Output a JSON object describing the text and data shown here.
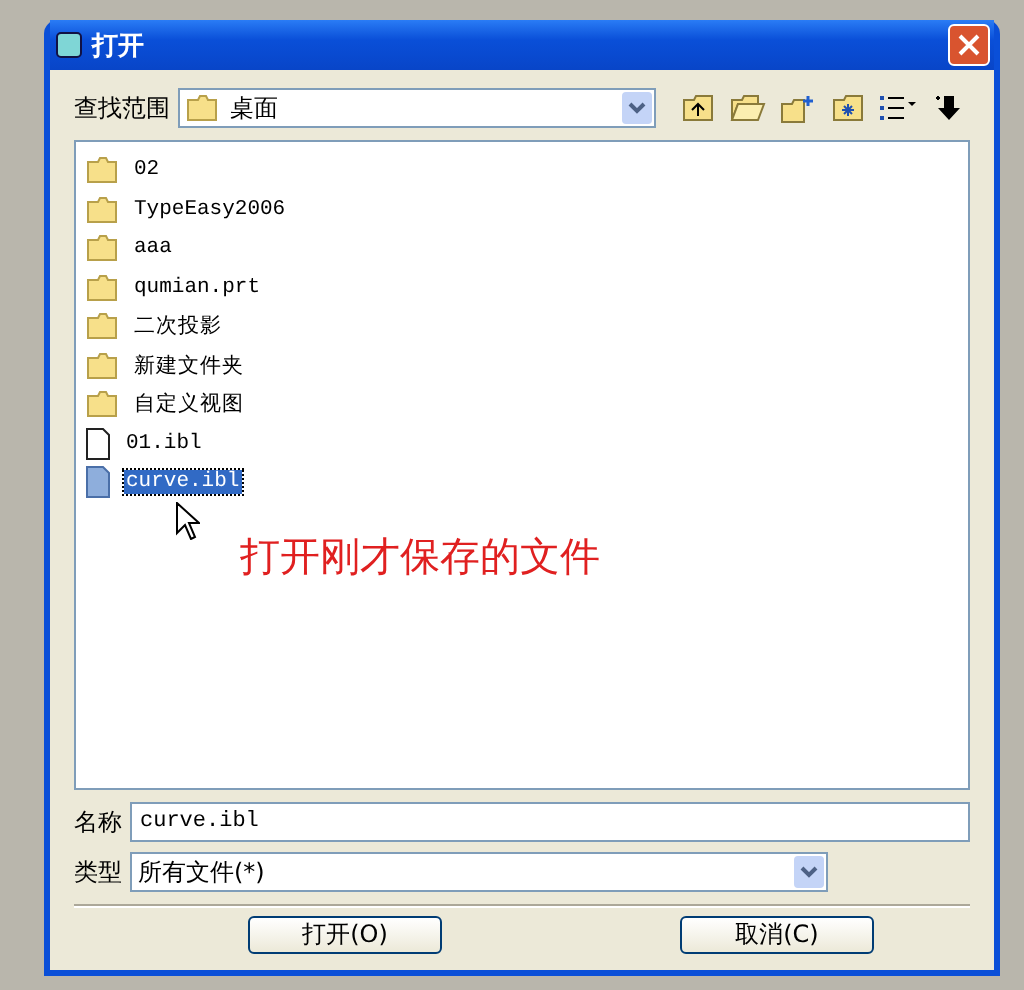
{
  "window": {
    "title": "打开"
  },
  "look_in": {
    "label": "查找范围",
    "value": "桌面"
  },
  "files": [
    {
      "name": "02",
      "kind": "folder",
      "selected": false
    },
    {
      "name": "TypeEasy2006",
      "kind": "folder",
      "selected": false
    },
    {
      "name": "aaa",
      "kind": "folder",
      "selected": false
    },
    {
      "name": "qumian.prt",
      "kind": "folder",
      "selected": false
    },
    {
      "name": "二次投影",
      "kind": "folder",
      "selected": false
    },
    {
      "name": "新建文件夹",
      "kind": "folder",
      "selected": false
    },
    {
      "name": "自定义视图",
      "kind": "folder",
      "selected": false
    },
    {
      "name": "01.ibl",
      "kind": "file",
      "selected": false
    },
    {
      "name": "curve.ibl",
      "kind": "file",
      "selected": true
    }
  ],
  "annotation": "打开刚才保存的文件",
  "file_name": {
    "label": "名称",
    "value": "curve.ibl"
  },
  "file_type": {
    "label": "类型",
    "value": "所有文件(*)"
  },
  "buttons": [
    "打开(O)",
    "取消(C)"
  ]
}
